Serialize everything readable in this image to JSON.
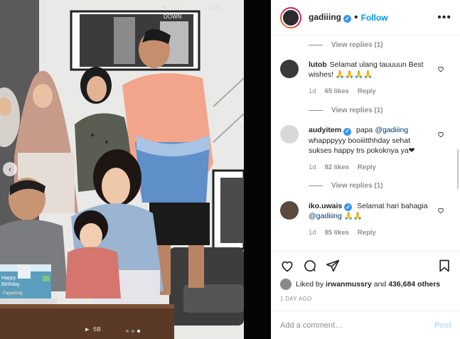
{
  "header": {
    "username": "gadiiing",
    "separator": "•",
    "follow_label": "Follow",
    "more_icon": "more-horizontal-icon"
  },
  "media": {
    "film_top_left": "▶ 15",
    "film_top_right": "SCRL",
    "film_bottom": "▶ 5B",
    "photo_signage": "DOWN",
    "cake_text_1": "Happy",
    "cake_text_2": "Birthday",
    "cake_text_3": "Papadong",
    "prev_icon": "chevron-left-icon",
    "slide_count": 3,
    "active_slide": 3
  },
  "comments": [
    {
      "view_replies": "View replies (1)"
    },
    {
      "user": "lutob",
      "verified": false,
      "text": "Selamat ulang tauuuun Best wishes! 🙏🙏🙏🙏",
      "time": "1d",
      "likes": "65 likes",
      "reply": "Reply",
      "avatar_color": "#3a3a3a"
    },
    {
      "view_replies": "View replies (1)"
    },
    {
      "user": "audyitem",
      "verified": true,
      "text_pre": "papa ",
      "mention": "@gadiiing",
      "text_post": " whapppyyy booiiitthhday sehat sukses happy trs pokoknya ya❤",
      "time": "1d",
      "likes": "82 likes",
      "reply": "Reply",
      "avatar_color": "#d8d8d8"
    },
    {
      "view_replies": "View replies (1)"
    },
    {
      "user": "iko.uwais",
      "verified": true,
      "text_pre": "Selamat hari bahagia ",
      "mention": "@gadiiing",
      "text_post": " 🙏🙏",
      "time": "1d",
      "likes": "85 likes",
      "reply": "Reply",
      "avatar_color": "#5a4b3e"
    }
  ],
  "actions": {
    "like_icon": "heart-icon",
    "comment_icon": "comment-icon",
    "share_icon": "share-icon",
    "save_icon": "bookmark-icon"
  },
  "liked_by": {
    "prefix": "Liked by ",
    "user": "irwanmussry",
    "middle": " and ",
    "count": "436,684 others"
  },
  "timestamp": "1 DAY AGO",
  "add_comment": {
    "placeholder": "Add a comment…",
    "post_label": "Post"
  }
}
